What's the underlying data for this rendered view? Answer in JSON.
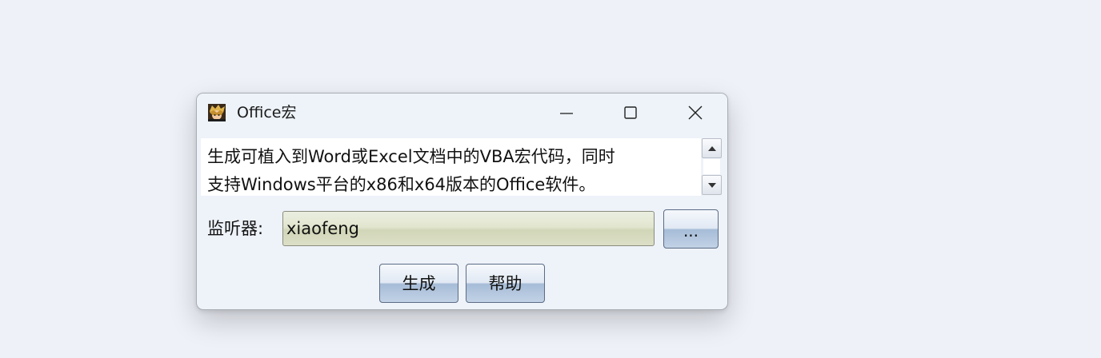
{
  "window": {
    "title": "Office宏",
    "icon": "anime-avatar-icon"
  },
  "description": {
    "line1": "生成可植入到Word或Excel文档中的VBA宏代码，同时",
    "line2": "支持Windows平台的x86和x64版本的Office软件。"
  },
  "listener": {
    "label": "监听器:",
    "value": "xiaofeng",
    "browse_label": "..."
  },
  "buttons": {
    "generate": "生成",
    "help": "帮助"
  },
  "colors": {
    "button_blue": "#a6bcd7",
    "input_fill": "#e2e6cf"
  }
}
